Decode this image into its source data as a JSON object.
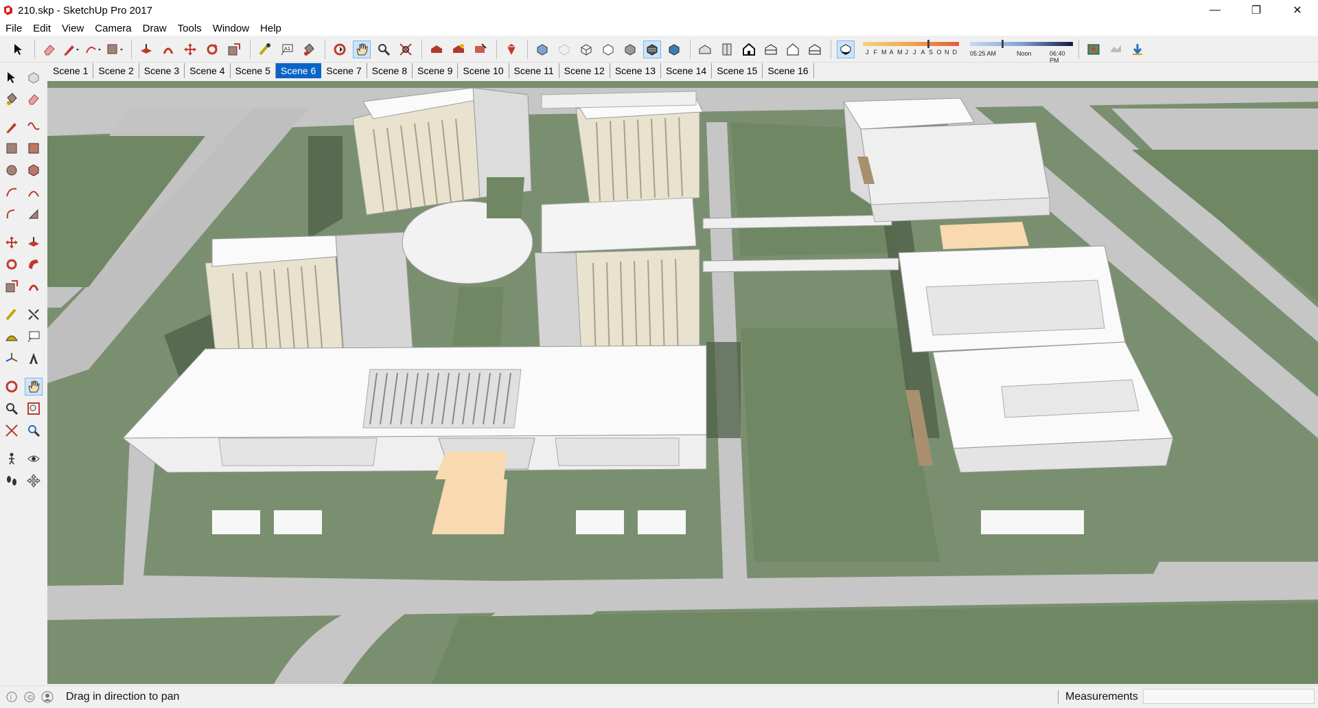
{
  "window": {
    "title": "210.skp - SketchUp Pro 2017",
    "controls": {
      "minimize": "—",
      "restore": "❐",
      "close": "✕"
    }
  },
  "menu": {
    "items": [
      "File",
      "Edit",
      "View",
      "Camera",
      "Draw",
      "Tools",
      "Window",
      "Help"
    ]
  },
  "toolbar": {
    "shadow_months": [
      "J",
      "F",
      "M",
      "A",
      "M",
      "J",
      "J",
      "A",
      "S",
      "O",
      "N",
      "D"
    ],
    "time_start": "05:25 AM",
    "time_noon": "Noon",
    "time_end": "06:40 PM",
    "active_tool": "pan-tool"
  },
  "scenes": {
    "tabs": [
      "Scene 1",
      "Scene 2",
      "Scene 3",
      "Scene 4",
      "Scene 5",
      "Scene 6",
      "Scene 7",
      "Scene 8",
      "Scene 9",
      "Scene 10",
      "Scene 11",
      "Scene 12",
      "Scene 13",
      "Scene 14",
      "Scene 15",
      "Scene 16"
    ],
    "active_index": 5
  },
  "status": {
    "message": "Drag in direction to pan",
    "measurements_label": "Measurements",
    "measurements_value": ""
  },
  "colors": {
    "grass": "#7a8f70",
    "road": "#c8c8c8",
    "building": "#f6f6f6",
    "accent": "#0a64c8"
  }
}
